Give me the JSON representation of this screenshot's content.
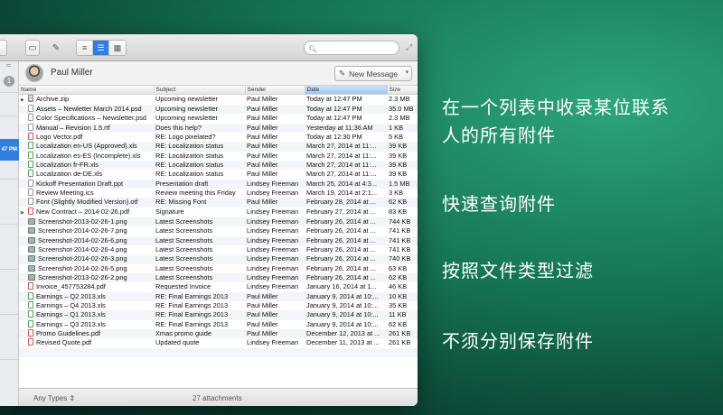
{
  "toolbar": {
    "search_placeholder": ""
  },
  "sidebar": {
    "badge": "1",
    "selected_time": "47 PM"
  },
  "contact": {
    "name": "Paul Miller",
    "new_message_label": "New Message"
  },
  "table": {
    "columns": [
      "Name",
      "Subject",
      "Sender",
      "Date",
      "Size"
    ],
    "sorted_column": "Date",
    "rows": [
      {
        "name": "Archive.zip",
        "icon": "zip",
        "expand": true,
        "subject": "Upcoming newsletter",
        "sender": "Paul Miller",
        "date": "Today at 12:47 PM",
        "size": "2.3 MB"
      },
      {
        "name": "Assets – Newletter March 2014.psd",
        "icon": "doc",
        "subject": "Upcoming newsletter",
        "sender": "Paul Miller",
        "date": "Today at 12:47 PM",
        "size": "35.0 MB"
      },
      {
        "name": "Color Specifications – Newsletter.psd",
        "icon": "doc",
        "subject": "Upcoming newsletter",
        "sender": "Paul Miller",
        "date": "Today at 12:47 PM",
        "size": "2.3 MB"
      },
      {
        "name": "Manual – Revision 1.5.rtf",
        "icon": "doc",
        "subject": "Does this help?",
        "sender": "Paul Miller",
        "date": "Yesterday at 11:36 AM",
        "size": "1 KB"
      },
      {
        "name": "Logo Vector.pdf",
        "icon": "pdf",
        "subject": "RE: Logo pixelated?",
        "sender": "Paul Miller",
        "date": "Today at 12:30 PM",
        "size": "5 KB"
      },
      {
        "name": "Localization en-US (Approved).xls",
        "icon": "xls",
        "subject": "RE: Localization status",
        "sender": "Paul Miller",
        "date": "March 27, 2014 at 11:...",
        "size": "39 KB"
      },
      {
        "name": "Localization es-ES (Incomplete).xls",
        "icon": "xls",
        "subject": "RE: Localization status",
        "sender": "Paul Miller",
        "date": "March 27, 2014 at 11:...",
        "size": "39 KB"
      },
      {
        "name": "Localization fr-FR.xls",
        "icon": "xls",
        "subject": "RE: Localization status",
        "sender": "Paul Miller",
        "date": "March 27, 2014 at 11:...",
        "size": "39 KB"
      },
      {
        "name": "Localization de-DE.xls",
        "icon": "xls",
        "subject": "RE: Localization status",
        "sender": "Paul Miller",
        "date": "March 27, 2014 at 11:...",
        "size": "39 KB"
      },
      {
        "name": "Kickoff Presentation Draft.ppt",
        "icon": "doc",
        "subject": "Presentation draft",
        "sender": "Lindsey Freeman",
        "date": "March 25, 2014 at 4:3...",
        "size": "1.5 MB"
      },
      {
        "name": "Review Meeting.ics",
        "icon": "doc",
        "subject": "Review meeting this Friday",
        "sender": "Lindsey Freeman",
        "date": "March 19, 2014 at 2:1...",
        "size": "3 KB"
      },
      {
        "name": "Font (Slightly Modified Version).otf",
        "icon": "doc",
        "subject": "RE: Missing Font",
        "sender": "Paul Miller",
        "date": "February 28, 2014 at ...",
        "size": "62 KB"
      },
      {
        "name": "New Contract – 2014-02-26.pdf",
        "icon": "pdf",
        "expand": true,
        "subject": "Signature",
        "sender": "Lindsey Freeman",
        "date": "February 27, 2014 at ...",
        "size": "83 KB"
      },
      {
        "name": "Screenshot-2013-02-26-1.png",
        "icon": "img",
        "subject": "Latest Screenshots",
        "sender": "Lindsey Freeman",
        "date": "February 26, 2014 at ...",
        "size": "744 KB"
      },
      {
        "name": "Screenshot-2014-02-26-7.png",
        "icon": "img",
        "subject": "Latest Screenshots",
        "sender": "Lindsey Freeman",
        "date": "February 26, 2014 at ...",
        "size": "741 KB"
      },
      {
        "name": "Screenshot-2014-02-26-6.png",
        "icon": "img",
        "subject": "Latest Screenshots",
        "sender": "Lindsey Freeman",
        "date": "February 26, 2014 at ...",
        "size": "741 KB"
      },
      {
        "name": "Screenshot-2014-02-26-4.png",
        "icon": "img",
        "subject": "Latest Screenshots",
        "sender": "Lindsey Freeman",
        "date": "February 26, 2014 at ...",
        "size": "741 KB"
      },
      {
        "name": "Screenshot-2014-02-26-3.png",
        "icon": "img",
        "subject": "Latest Screenshots",
        "sender": "Lindsey Freeman",
        "date": "February 26, 2014 at ...",
        "size": "740 KB"
      },
      {
        "name": "Screenshot-2014-02-26-5.png",
        "icon": "img",
        "subject": "Latest Screenshots",
        "sender": "Lindsey Freeman",
        "date": "February 26, 2014 at ...",
        "size": "63 KB"
      },
      {
        "name": "Screenshot-2013-02-26-2.png",
        "icon": "img",
        "subject": "Latest Screenshots",
        "sender": "Lindsey Freeman",
        "date": "February 26, 2014 at ...",
        "size": "62 KB"
      },
      {
        "name": "Invoice_457753284.pdf",
        "icon": "pdf",
        "subject": "Requested Invoice",
        "sender": "Lindsey Freeman",
        "date": "January 16, 2014 at 1...",
        "size": "46 KB"
      },
      {
        "name": "Earnings – Q2 2013.xls",
        "icon": "xls",
        "subject": "RE: Final Earnings 2013",
        "sender": "Paul Miller",
        "date": "January 9, 2014 at 10:...",
        "size": "10 KB"
      },
      {
        "name": "Earnings – Q4 2013.xls",
        "icon": "xls",
        "subject": "RE: Final Earnings 2013",
        "sender": "Paul Miller",
        "date": "January 9, 2014 at 10:...",
        "size": "35 KB"
      },
      {
        "name": "Earnings – Q1 2013.xls",
        "icon": "xls",
        "subject": "RE: Final Earnings 2013",
        "sender": "Paul Miller",
        "date": "January 9, 2014 at 10:...",
        "size": "11 KB"
      },
      {
        "name": "Earnings – Q3 2013.xls",
        "icon": "xls",
        "subject": "RE: Final Earnings 2013",
        "sender": "Paul Miller",
        "date": "January 9, 2014 at 10:...",
        "size": "62 KB"
      },
      {
        "name": "Promo Guidelines.pdf",
        "icon": "pdf",
        "subject": "Xmas promo guide",
        "sender": "Paul Miller",
        "date": "December 12, 2013 at ...",
        "size": "261 KB"
      },
      {
        "name": "Revised Quote.pdf",
        "icon": "pdf",
        "subject": "Updated quote",
        "sender": "Lindsey Freeman",
        "date": "December 11, 2013 at ...",
        "size": "261 KB"
      }
    ]
  },
  "footer": {
    "types_label": "Any Types",
    "count_label": "27 attachments"
  },
  "features": [
    {
      "line1": "在一个列表中收录某位联系",
      "line2": "人的所有附件"
    },
    {
      "line1": "快速查询附件",
      "line2": ""
    },
    {
      "line1": "按照文件类型过滤",
      "line2": ""
    },
    {
      "line1": "不须分别保存附件",
      "line2": ""
    }
  ]
}
